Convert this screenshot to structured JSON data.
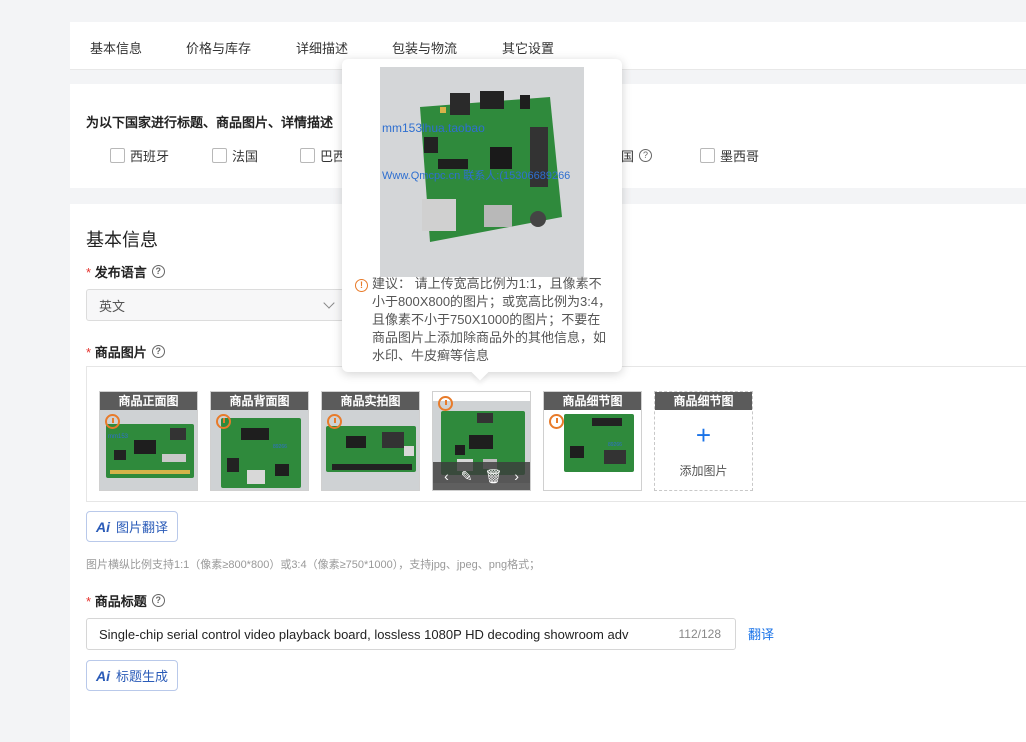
{
  "tabs": [
    "基本信息",
    "价格与库存",
    "详细描述",
    "包装与物流",
    "其它设置"
  ],
  "countries": {
    "title": "为以下国家进行标题、商品图片、详情描述",
    "items": [
      "西班牙",
      "法国",
      "巴西",
      "泰国",
      "墨西哥"
    ]
  },
  "basic": {
    "section_title": "基本信息",
    "language_label": "发布语言",
    "language_value": "英文",
    "images_label": "商品图片",
    "image_slots": [
      "商品正面图",
      "商品背面图",
      "商品实拍图",
      "",
      "商品细节图",
      "商品细节图"
    ],
    "add_image_text": "添加图片",
    "image_translate_btn": "图片翻译",
    "image_hint": "图片横纵比例支持1:1（像素≥800*800）或3:4（像素≥750*1000），支持jpg、jpeg、png格式；",
    "title_label": "商品标题",
    "title_value": "Single-chip serial control video playback board, lossless 1080P HD decoding showroom adv",
    "title_count": "112/128",
    "translate_link": "翻译",
    "title_gen_btn": "标题生成"
  },
  "popover": {
    "watermark1": "mm153lhua.taobao",
    "watermark2": "Www.Qmcpc.cn 联系人:(15306689266",
    "tip": "建议： 请上传宽高比例为1:1，且像素不小于800X800的图片；或宽高比例为3:4，且像素不小于750X1000的图片；不要在商品图片上添加除商品外的其他信息，如水印、牛皮癣等信息"
  },
  "colors": {
    "accent": "#1a73e8",
    "required": "#e5322d",
    "warning": "#e87b2a",
    "pcb": "#2f8a3c"
  }
}
